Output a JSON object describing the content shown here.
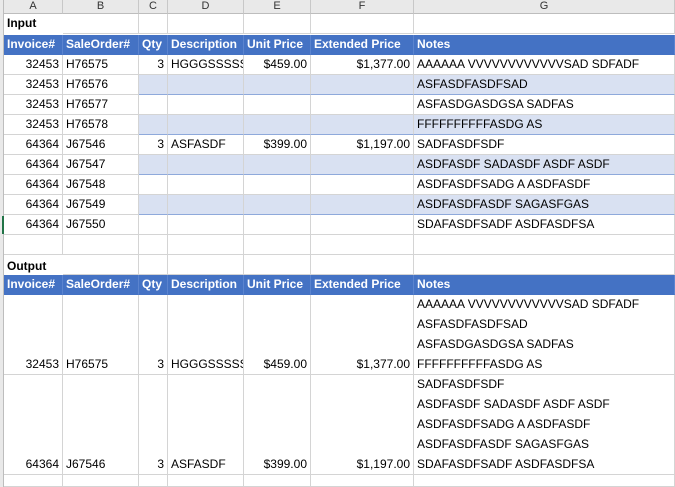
{
  "columns": [
    "A",
    "B",
    "C",
    "D",
    "E",
    "F",
    "G"
  ],
  "headers": [
    "Invoice#",
    "SaleOrder#",
    "Qty",
    "Description",
    "Unit Price",
    "Extended Price",
    "Notes"
  ],
  "input": {
    "label": "Input",
    "rows": [
      [
        "32453",
        "H76575",
        "3",
        "HGGGSSSSS",
        "$459.00",
        "$1,377.00",
        "AAAAAA VVVVVVVVVVVVSAD SDFADF"
      ],
      [
        "32453",
        "H76576",
        "",
        "",
        "",
        "",
        "ASFASDFASDFSAD"
      ],
      [
        "32453",
        "H76577",
        "",
        "",
        "",
        "",
        "ASFASDGASDGSA SADFAS"
      ],
      [
        "32453",
        "H76578",
        "",
        "",
        "",
        "",
        "FFFFFFFFFFASDG AS"
      ],
      [
        "64364",
        "J67546",
        "3",
        "ASFASDF",
        "$399.00",
        "$1,197.00",
        "SADFASDFSDF"
      ],
      [
        "64364",
        "J67547",
        "",
        "",
        "",
        "",
        "ASDFASDF  SADASDF  ASDF ASDF"
      ],
      [
        "64364",
        "J67548",
        "",
        "",
        "",
        "",
        "ASDFASDFSADG A ASDFASDF"
      ],
      [
        "64364",
        "J67549",
        "",
        "",
        "",
        "",
        "ASDFASDFASDF   SAGASFGAS"
      ],
      [
        "64364",
        "J67550",
        "",
        "",
        "",
        "",
        "SDAFASDFSADF  ASDFASDFSA"
      ]
    ]
  },
  "output": {
    "label": "Output",
    "rows": [
      {
        "cells": [
          "32453",
          "H76575",
          "3",
          "HGGGSSSSS",
          "$459.00",
          "$1,377.00"
        ],
        "notes": [
          "AAAAAA VVVVVVVVVVVVSAD SDFADF",
          "ASFASDFASDFSAD",
          "ASFASDGASDGSA SADFAS",
          "FFFFFFFFFFASDG AS"
        ]
      },
      {
        "cells": [
          "64364",
          "J67546",
          "3",
          "ASFASDF",
          "$399.00",
          "$1,197.00"
        ],
        "notes": [
          "SADFASDFSDF",
          "ASDFASDF  SADASDF  ASDF ASDF",
          "ASDFASDFSADG A ASDFASDF",
          "ASDFASDFASDF   SAGASFGAS",
          "SDAFASDFSADF  ASDFASDFSA"
        ]
      }
    ]
  }
}
